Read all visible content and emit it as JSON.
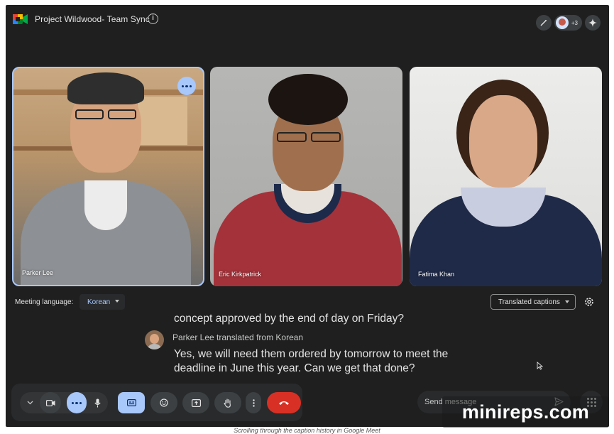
{
  "header": {
    "title": "Project Wildwood- Team Sync",
    "info_icon": "info-icon",
    "participant_extra_count": "+3"
  },
  "tiles": [
    {
      "name": "Parker Lee",
      "speaking": true
    },
    {
      "name": "Eric Kirkpatrick",
      "speaking": false
    },
    {
      "name": "Fatima Khan",
      "speaking": false
    }
  ],
  "language": {
    "label": "Meeting language:",
    "value": "Korean"
  },
  "captions_mode": {
    "value": "Translated captions"
  },
  "captions": {
    "previous_line": "concept approved by the end of day on Friday?",
    "speaker": "Parker Lee translated from Korean",
    "text": "Yes, we will need them ordered by tomorrow to meet the deadline in June this year. Can we get that done?"
  },
  "message": {
    "placeholder": "Send message"
  },
  "watermark": "minireps.com",
  "footnote": "Scrolling through the caption history in Google Meet",
  "colors": {
    "background": "#1f1f1f",
    "accent_blue": "#a8c7fa",
    "end_call_red": "#d93025",
    "surface": "#282a2c"
  }
}
